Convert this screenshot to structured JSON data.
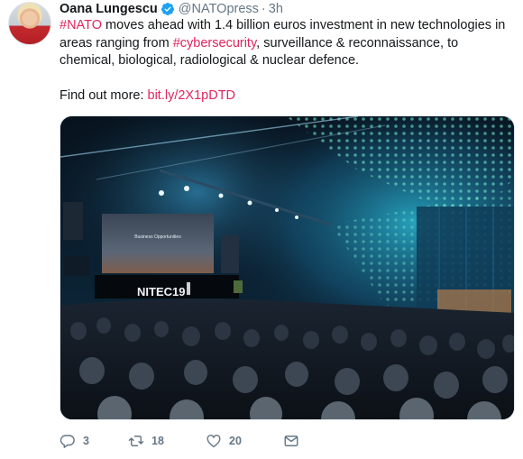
{
  "tweet": {
    "author_name": "Oana Lungescu",
    "handle": "@NATOpress",
    "separator": "·",
    "time": "3h",
    "text": {
      "hashtag_nato": "#NATO",
      "part1": " moves ahead with 1.4 billion euros investment in new technologies in areas ranging from ",
      "hashtag_cyber": "#cybersecurity",
      "part2": ", surveillance & reconnaissance, to chemical, biological, radiological & nuclear defence.",
      "find_more": "Find out more: ",
      "link": "bit.ly/2X1pDTD"
    },
    "media": {
      "screen_text": "Business Opportunities",
      "stage_logo": "NITEC19"
    },
    "actions": {
      "replies": "3",
      "retweets": "18",
      "likes": "20"
    }
  },
  "colors": {
    "accent": "#e0245e",
    "verified": "#1da1f2",
    "muted": "#657786",
    "text": "#14171a"
  },
  "icons": [
    "verified-badge-icon",
    "reply-icon",
    "retweet-icon",
    "like-icon",
    "direct-message-icon"
  ]
}
